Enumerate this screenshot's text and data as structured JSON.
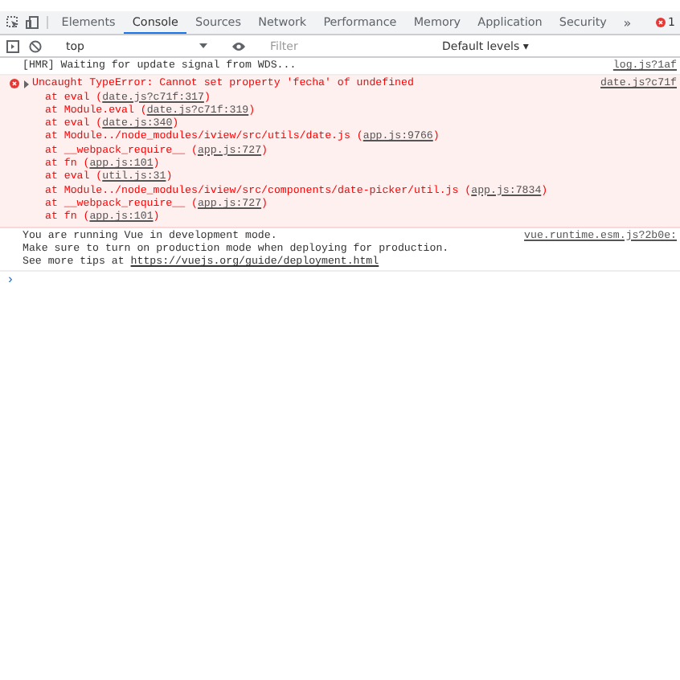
{
  "tabs": [
    {
      "label": "Elements",
      "selected": false
    },
    {
      "label": "Console",
      "selected": true
    },
    {
      "label": "Sources",
      "selected": false
    },
    {
      "label": "Network",
      "selected": false
    },
    {
      "label": "Performance",
      "selected": false
    },
    {
      "label": "Memory",
      "selected": false
    },
    {
      "label": "Application",
      "selected": false
    },
    {
      "label": "Security",
      "selected": false
    }
  ],
  "more_tabs": "»",
  "error_count": "1",
  "toolbar": {
    "context": "top",
    "filter_placeholder": "Filter",
    "levels": "Default levels ▾"
  },
  "messages": [
    {
      "kind": "log",
      "lines": [
        "[HMR] Waiting for update signal from WDS..."
      ],
      "source": "log.js?1af"
    },
    {
      "kind": "error",
      "lines": [
        "Uncaught TypeError: Cannot set property 'fecha' of undefined"
      ],
      "source": "date.js?c71f",
      "expanded": false,
      "stack": [
        {
          "prefix": "at eval (",
          "link": "date.js?c71f:317",
          "suffix": ")"
        },
        {
          "prefix": "at Module.eval (",
          "link": "date.js?c71f:319",
          "suffix": ")"
        },
        {
          "prefix": "at eval (",
          "link": "date.js:340",
          "suffix": ")"
        },
        {
          "prefix": "at Module../node_modules/iview/src/utils/date.js (",
          "link": "app.js:9766",
          "suffix": ")"
        },
        {
          "prefix": "at __webpack_require__ (",
          "link": "app.js:727",
          "suffix": ")"
        },
        {
          "prefix": "at fn (",
          "link": "app.js:101",
          "suffix": ")"
        },
        {
          "prefix": "at eval (",
          "link": "util.js:31",
          "suffix": ")"
        },
        {
          "prefix": "at Module../node_modules/iview/src/components/date-picker/util.js (",
          "link": "app.js:7834",
          "suffix": ")"
        },
        {
          "prefix": "at __webpack_require__ (",
          "link": "app.js:727",
          "suffix": ")"
        },
        {
          "prefix": "at fn (",
          "link": "app.js:101",
          "suffix": ")"
        }
      ]
    },
    {
      "kind": "log",
      "lines": [
        "You are running Vue in development mode.",
        "Make sure to turn on production mode when deploying for production."
      ],
      "tail": {
        "prefix": "See more tips at ",
        "link": "https://vuejs.org/guide/deployment.html"
      },
      "source": "vue.runtime.esm.js?2b0e:"
    }
  ],
  "prompt": "›"
}
